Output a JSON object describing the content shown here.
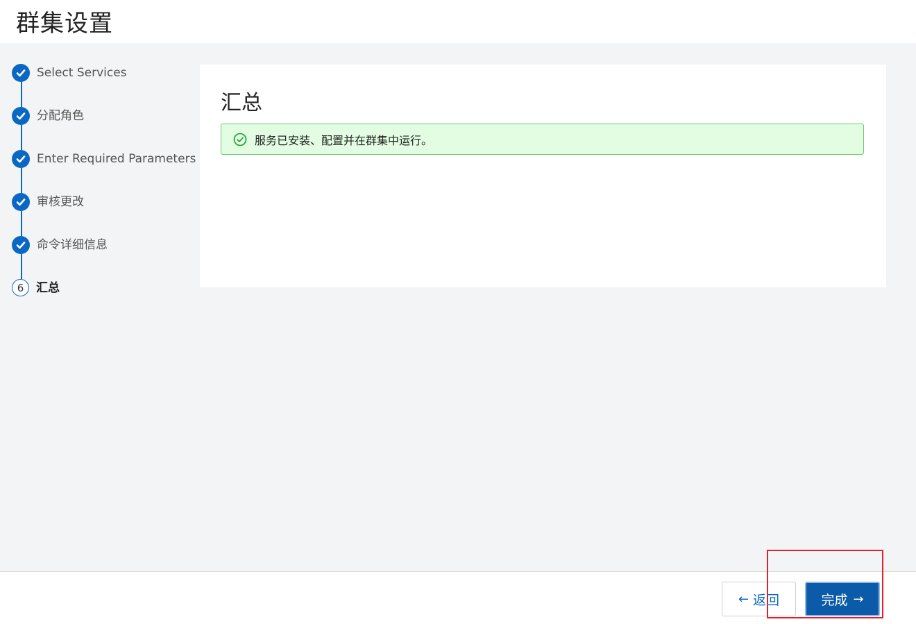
{
  "header": {
    "title": "群集设置"
  },
  "steps": [
    {
      "label": "Select Services",
      "state": "done",
      "icon": "check-icon"
    },
    {
      "label": "分配角色",
      "state": "done",
      "icon": "check-icon"
    },
    {
      "label": "Enter Required Parameters",
      "state": "done",
      "icon": "check-icon"
    },
    {
      "label": "审核更改",
      "state": "done",
      "icon": "check-icon"
    },
    {
      "label": "命令详细信息",
      "state": "done",
      "icon": "check-icon"
    },
    {
      "label": "汇总",
      "state": "current",
      "number": "6"
    }
  ],
  "summary": {
    "title": "汇总",
    "alert_message": "服务已安装、配置并在群集中运行。",
    "alert_icon": "success-check-circle-icon"
  },
  "footer": {
    "back_label": "返回",
    "back_icon": "arrow-left-icon",
    "finish_label": "完成",
    "finish_icon": "arrow-right-icon"
  },
  "colors": {
    "primary": "#0a68c4",
    "success_bg": "#e3fde3",
    "success_border": "#6cc96c",
    "highlight": "#e0202a"
  }
}
